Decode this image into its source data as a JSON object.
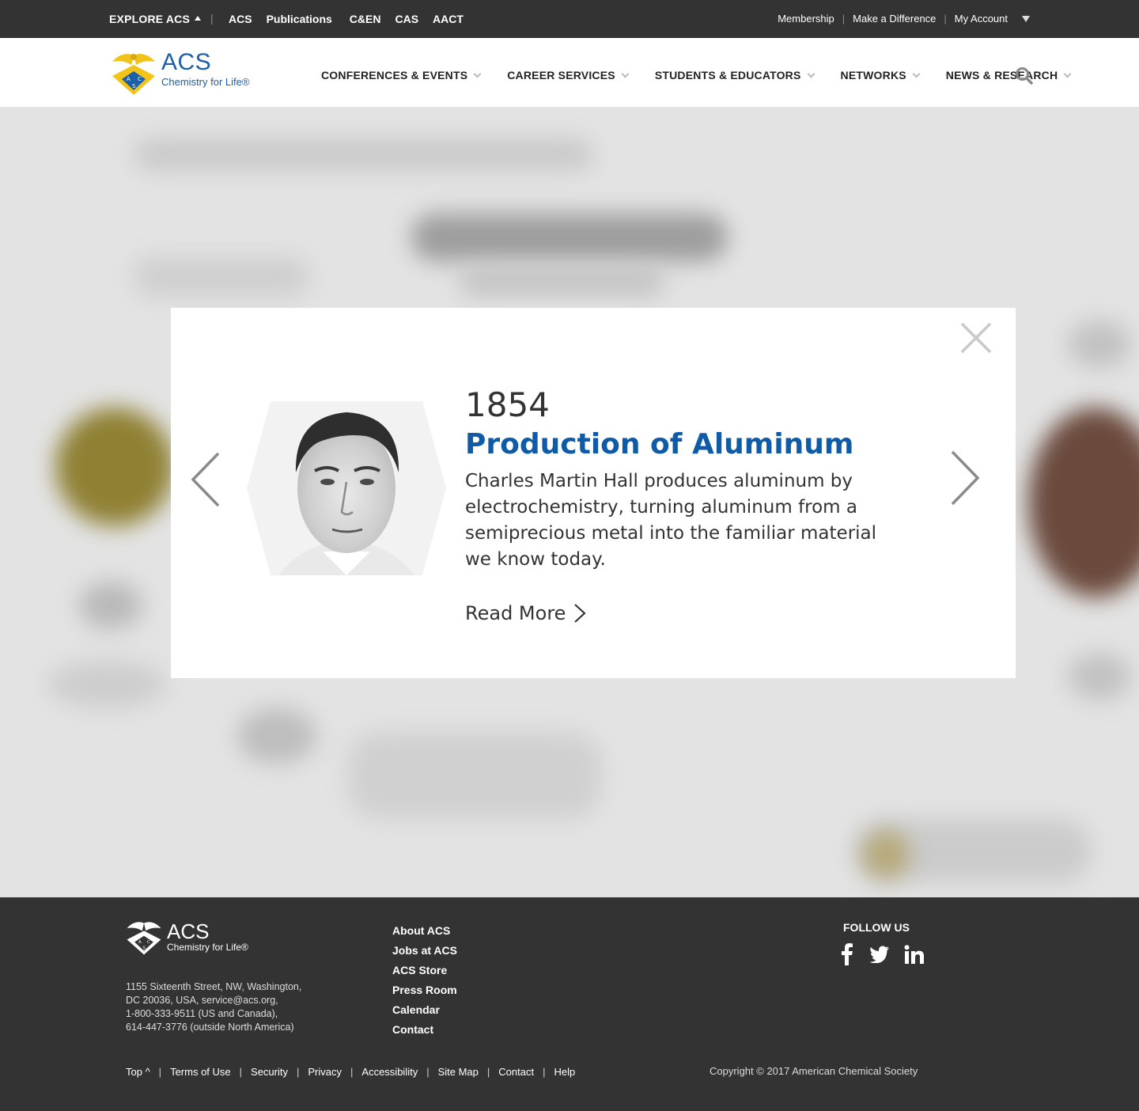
{
  "topbar": {
    "explore_label": "EXPLORE ACS",
    "separator": "|",
    "brands": [
      "ACS",
      "Publications",
      "C&EN",
      "CAS",
      "AACT"
    ],
    "right_links": [
      "Membership",
      "Make a Difference",
      "My Account"
    ],
    "pipe": "|"
  },
  "header": {
    "logo_text": "ACS",
    "logo_tagline": "Chemistry for Life®",
    "nav": [
      "CONFERENCES & EVENTS",
      "CAREER SERVICES",
      "STUDENTS & EDUCATORS",
      "NETWORKS",
      "NEWS & RESEARCH"
    ]
  },
  "modal": {
    "year": "1854",
    "title": "Production of Aluminum",
    "description": "Charles Martin Hall produces aluminum by electrochemistry, turning aluminum from a semiprecious metal into the familiar material we know today.",
    "read_more": "Read More"
  },
  "footer": {
    "logo_text": "ACS",
    "logo_tagline": "Chemistry for Life®",
    "address": [
      "1155 Sixteenth Street, NW, Washington,",
      "DC 20036, USA, service@acs.org,",
      "1-800-333-9511 (US and Canada),",
      "614-447-3776 (outside North America)"
    ],
    "links": [
      "About ACS",
      "Jobs at ACS",
      "ACS Store",
      "Press Room",
      "Calendar",
      "Contact"
    ],
    "follow_us": "FOLLOW US",
    "social_icons": [
      "facebook-icon",
      "twitter-icon",
      "linkedin-icon"
    ],
    "bottom_links": [
      "Top ^",
      "Terms of Use",
      "Security",
      "Privacy",
      "Accessibility",
      "Site Map",
      "Contact",
      "Help"
    ],
    "bottom_sep": "|",
    "copyright": "Copyright © 2017 American Chemical Society"
  },
  "colors": {
    "dark_bar": "#333333",
    "brand_blue": "#0f5ba8",
    "logo_gold": "#f2c318"
  }
}
